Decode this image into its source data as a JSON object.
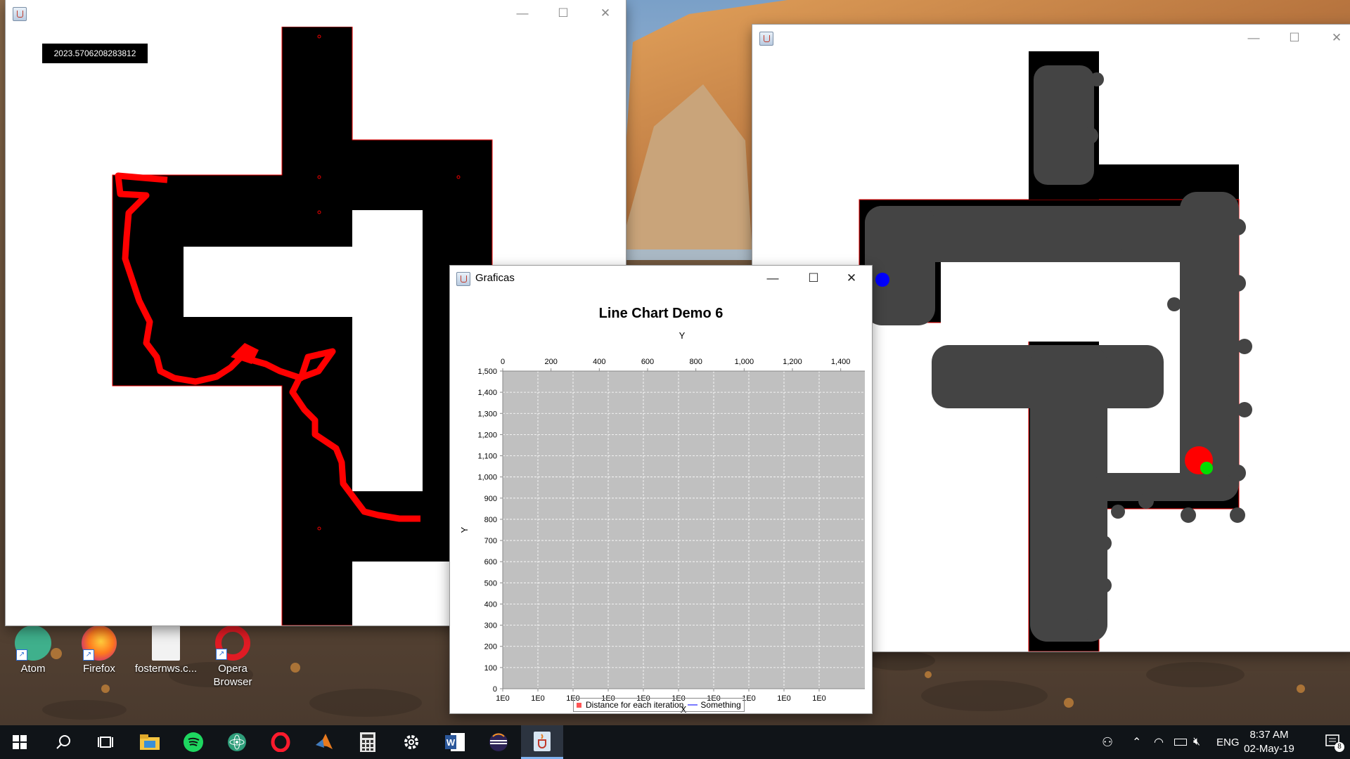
{
  "desktop": {
    "icons": [
      {
        "label": "Atom"
      },
      {
        "label": "Firefox"
      },
      {
        "label": "fosternws.c..."
      },
      {
        "label": "Opera\nBrowser"
      }
    ]
  },
  "window_left": {
    "title": "",
    "distance_readout": "2023.5706208283812"
  },
  "window_right": {
    "title": ""
  },
  "window_chart": {
    "title": "Graficas"
  },
  "chart_data": {
    "type": "line",
    "title": "Line Chart Demo 6",
    "top_axis_label": "Y",
    "xlabel": "X",
    "ylabel": "Y",
    "top_ticks": [
      "0",
      "200",
      "400",
      "600",
      "800",
      "1,000",
      "1,200",
      "1,400"
    ],
    "top_range": [
      0,
      1500
    ],
    "y_ticks": [
      "0",
      "100",
      "200",
      "300",
      "400",
      "500",
      "600",
      "700",
      "800",
      "900",
      "1,000",
      "1,100",
      "1,200",
      "1,300",
      "1,400",
      "1,500"
    ],
    "ylim": [
      0,
      1500
    ],
    "x_ticks": [
      "1E0",
      "1E0",
      "1E0",
      "1E0",
      "1E0",
      "1E0",
      "1E0",
      "1E0",
      "1E0",
      "1E0"
    ],
    "grid": true,
    "plot_background": "#c0c0c0",
    "series": [
      {
        "name": "Distance for each iteration",
        "color": "#ff5555",
        "values": []
      },
      {
        "name": "Something",
        "color": "#5555ff",
        "values": []
      }
    ],
    "legend_position": "bottom"
  },
  "window_buttons": {
    "minimize": "—",
    "maximize": "☐",
    "close": "✕"
  },
  "taskbar": {
    "apps": [
      "start-icon",
      "search-icon",
      "task-view-icon",
      "file-explorer-icon",
      "spotify-icon",
      "atom-icon",
      "opera-icon",
      "matlab-icon",
      "calculator-icon",
      "settings-icon",
      "word-icon",
      "eclipse-icon",
      "java-icon"
    ],
    "language": "ENG",
    "time": "8:37 AM",
    "date": "02-May-19",
    "notifications": "8"
  }
}
